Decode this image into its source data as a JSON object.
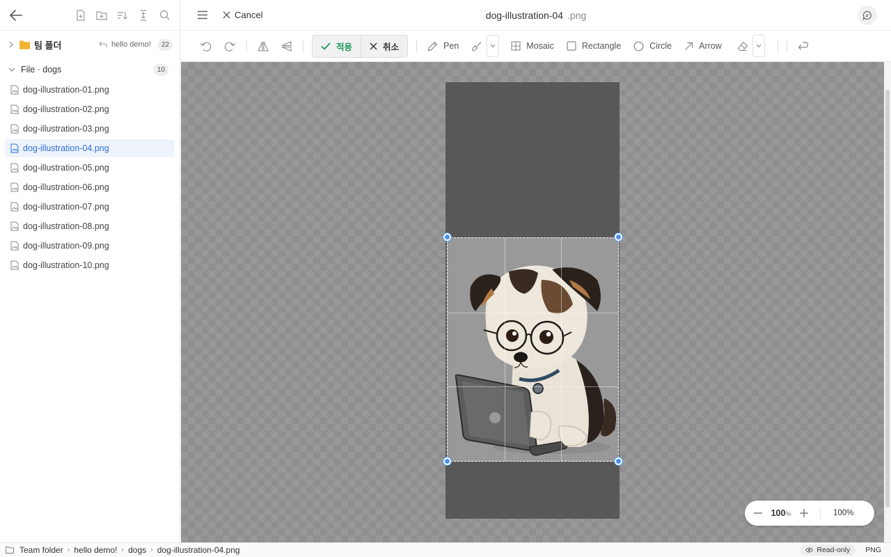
{
  "sidebar": {
    "team_folder": {
      "name": "팀 폴더",
      "sub": "hello demo!",
      "count": "22"
    },
    "section": {
      "label": "File · dogs",
      "count": "10"
    },
    "files": [
      {
        "name": "dog-illustration-01.png"
      },
      {
        "name": "dog-illustration-02.png"
      },
      {
        "name": "dog-illustration-03.png"
      },
      {
        "name": "dog-illustration-04.png",
        "active": true
      },
      {
        "name": "dog-illustration-05.png"
      },
      {
        "name": "dog-illustration-06.png"
      },
      {
        "name": "dog-illustration-07.png"
      },
      {
        "name": "dog-illustration-08.png"
      },
      {
        "name": "dog-illustration-09.png"
      },
      {
        "name": "dog-illustration-10.png"
      }
    ]
  },
  "header": {
    "cancel_label": "Cancel",
    "title": "dog-illustration-04",
    "extension": ".png"
  },
  "toolbar": {
    "apply_label": "적용",
    "cancel_label": "취소",
    "pen_label": "Pen",
    "mosaic_label": "Mosaic",
    "rectangle_label": "Rectangle",
    "circle_label": "Circle",
    "arrow_label": "Arrow"
  },
  "zoom": {
    "value": "100",
    "unit": "%",
    "reset_label": "100%"
  },
  "statusbar": {
    "breadcrumb": [
      "Team folder",
      "hello demo!",
      "dogs",
      "dog-illustration-04.png"
    ],
    "readonly_label": "Read-only",
    "format": "PNG"
  },
  "colors": {
    "accent": "#2c6fd6",
    "apply_green": "#1a9b5c",
    "handle_blue": "#4a8fe9",
    "canvas_bg": "#989898"
  }
}
